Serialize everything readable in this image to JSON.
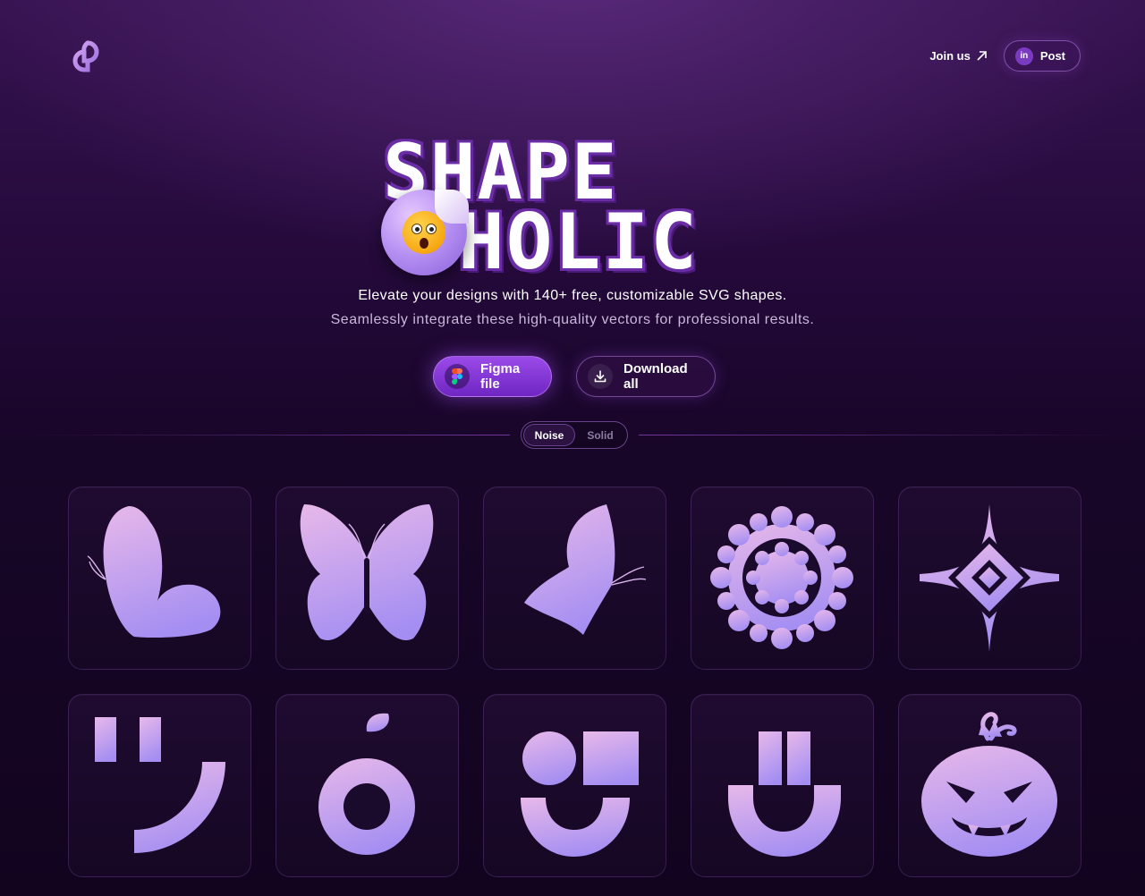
{
  "header": {
    "logo_icon": "shapeholic-logo-icon",
    "join_label": "Join us",
    "join_icon": "arrow-up-right-icon",
    "post_badge": "in",
    "post_label": "Post"
  },
  "hero": {
    "title_line1": "SHAPE",
    "title_line2": "HOLIC",
    "sticker_icon": "shocked-face-emoji-icon",
    "subtitle1": "Elevate your designs with 140+ free, customizable SVG shapes.",
    "subtitle2": "Seamlessly integrate these high-quality vectors for professional results."
  },
  "actions": {
    "figma_label": "Figma file",
    "figma_icon": "figma-icon",
    "download_label": "Download all",
    "download_icon": "download-icon"
  },
  "style_toggle": {
    "options": [
      "Noise",
      "Solid"
    ],
    "selected": "Noise"
  },
  "shapes": [
    {
      "name": "butterfly-side-shape"
    },
    {
      "name": "butterfly-front-shape"
    },
    {
      "name": "butterfly-wing-shape"
    },
    {
      "name": "flower-ring-shape"
    },
    {
      "name": "four-point-star-shape"
    },
    {
      "name": "smile-bracket-shape"
    },
    {
      "name": "ring-drop-shape"
    },
    {
      "name": "circle-square-smile-shape"
    },
    {
      "name": "u-bars-shape"
    },
    {
      "name": "pumpkin-shape"
    }
  ],
  "colors": {
    "accent": "#8b3fdc",
    "shape_gradient_top": "#e2b4ea",
    "shape_gradient_bottom": "#a88ff0",
    "background": "#1a0629"
  }
}
